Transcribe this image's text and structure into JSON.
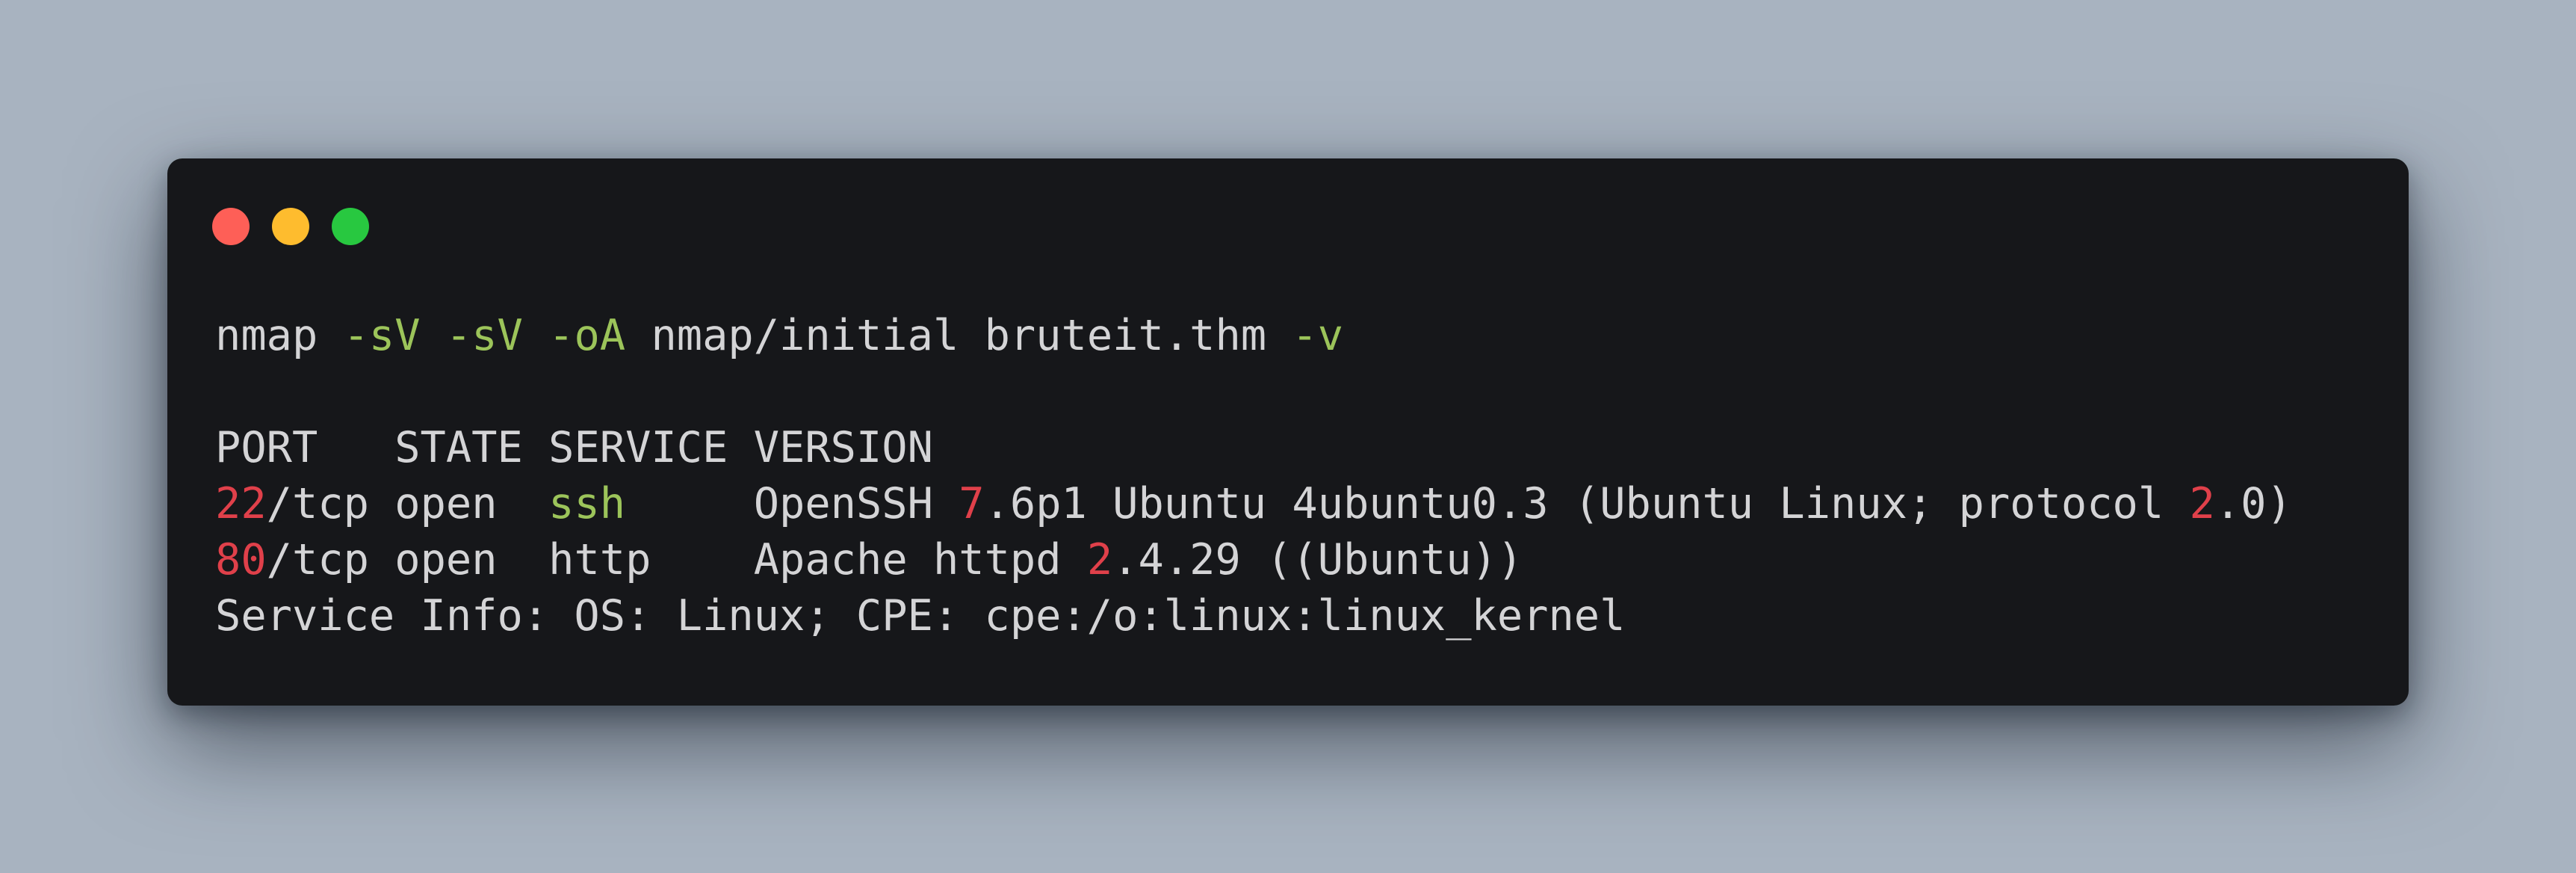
{
  "colors": {
    "page_background": "#a8b3c0",
    "terminal_background": "#16171a",
    "text": "#d4d4d6",
    "flag_green": "#9cc45a",
    "number_red": "#e0404a",
    "close_dot": "#fe5f57",
    "minimize_dot": "#febc2e",
    "maximize_dot": "#28c840"
  },
  "window_controls": [
    "close-dot",
    "minimize-dot",
    "maximize-dot"
  ],
  "command": {
    "program": "nmap",
    "flag1": "-sV",
    "flag2": "-sV",
    "flag3": "-oA",
    "output_path": "nmap/initial",
    "target": "bruteit.thm",
    "flag4": "-v"
  },
  "header": {
    "port": "PORT",
    "state": "STATE",
    "service": "SERVICE",
    "version": "VERSION"
  },
  "rows": [
    {
      "port_num": "22",
      "port_proto": "/tcp",
      "state": "open",
      "service": "ssh",
      "version_parts": [
        "OpenSSH ",
        "7",
        ".6p1 Ubuntu 4ubuntu0.3 (Ubuntu Linux; protocol ",
        "2",
        ".0)"
      ]
    },
    {
      "port_num": "80",
      "port_proto": "/tcp",
      "state": "open",
      "service": "http",
      "version_parts": [
        "Apache httpd ",
        "2",
        ".4.29 ((Ubuntu))"
      ]
    }
  ],
  "service_info": "Service Info: OS: Linux; CPE: cpe:/o:linux:linux_kernel"
}
